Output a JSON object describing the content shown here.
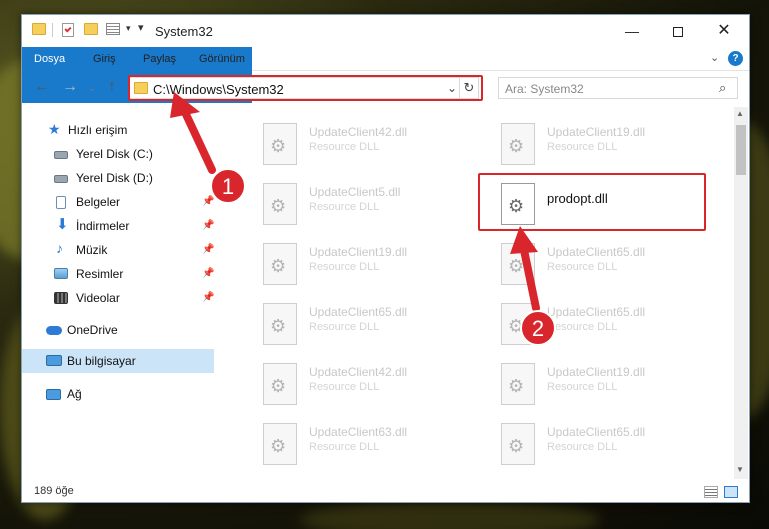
{
  "window": {
    "title": "System32",
    "ribbon_tabs": [
      "Dosya",
      "Giriş",
      "Paylaş",
      "Görünüm"
    ],
    "help_label": "?"
  },
  "address": {
    "path": "C:\\Windows\\System32",
    "search_placeholder": "Ara: System32"
  },
  "nav": {
    "items": [
      {
        "label": "Hızlı erişim",
        "icon": "star-icon"
      },
      {
        "label": "Yerel Disk (C:)",
        "icon": "drive-icon"
      },
      {
        "label": "Yerel Disk (D:)",
        "icon": "drive-icon"
      },
      {
        "label": "Belgeler",
        "icon": "documents-icon"
      },
      {
        "label": "İndirmeler",
        "icon": "download-icon"
      },
      {
        "label": "Müzik",
        "icon": "music-icon"
      },
      {
        "label": "Resimler",
        "icon": "pictures-icon"
      },
      {
        "label": "Videolar",
        "icon": "video-icon"
      },
      {
        "label": "OneDrive",
        "icon": "cloud-icon"
      },
      {
        "label": "Bu bilgisayar",
        "icon": "computer-icon"
      },
      {
        "label": "Ağ",
        "icon": "network-icon"
      }
    ]
  },
  "files": [
    {
      "name": "UpdateClient42.dll",
      "type": "Resource DLL"
    },
    {
      "name": "UpdateClient19.dll",
      "type": "Resource DLL"
    },
    {
      "name": "UpdateClient5.dll",
      "type": "Resource DLL"
    },
    {
      "name": "prodopt.dll",
      "type": ""
    },
    {
      "name": "UpdateClient19.dll",
      "type": "Resource DLL"
    },
    {
      "name": "UpdateClient65.dll",
      "type": "Resource DLL"
    },
    {
      "name": "UpdateClient65.dll",
      "type": "Resource DLL"
    },
    {
      "name": "UpdateClient65.dll",
      "type": "Resource DLL"
    },
    {
      "name": "UpdateClient42.dll",
      "type": "Resource DLL"
    },
    {
      "name": "UpdateClient19.dll",
      "type": "Resource DLL"
    },
    {
      "name": "UpdateClient63.dll",
      "type": "Resource DLL"
    },
    {
      "name": "UpdateClient65.dll",
      "type": "Resource DLL"
    }
  ],
  "status": {
    "item_count": "189 öğe"
  },
  "annotations": {
    "step1": "1",
    "step2": "2",
    "color": "#d9262c"
  }
}
